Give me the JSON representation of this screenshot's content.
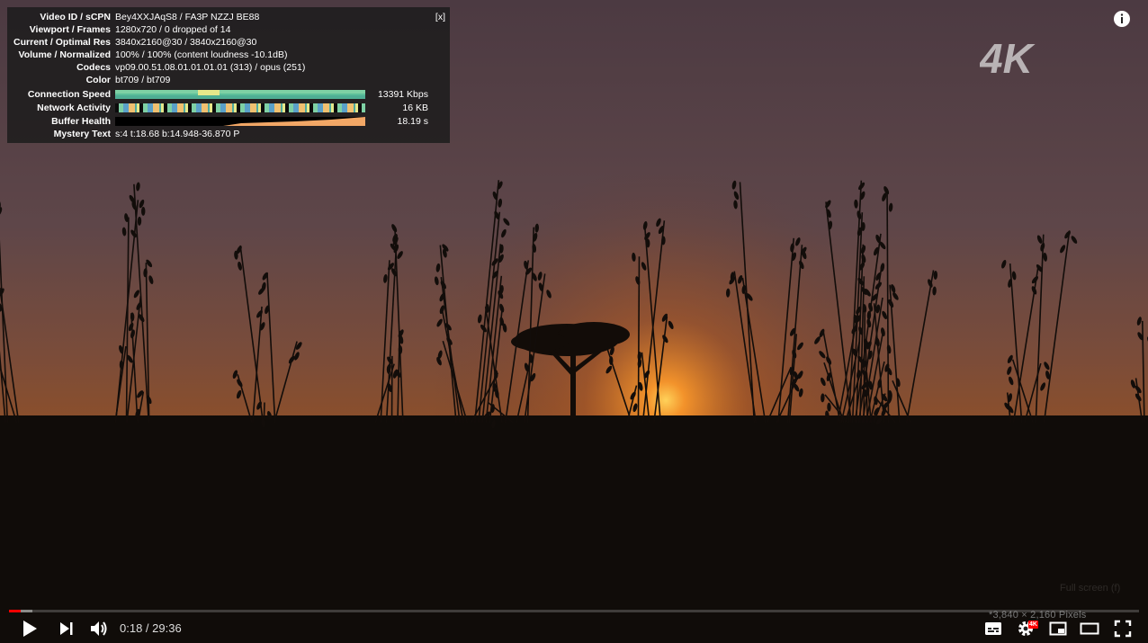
{
  "stats_panel": {
    "close_label": "[x]",
    "rows": [
      {
        "label": "Video ID / sCPN",
        "value": "Bey4XXJAqS8 / FA3P NZZJ BE88"
      },
      {
        "label": "Viewport / Frames",
        "value": "1280x720 / 0 dropped of 14"
      },
      {
        "label": "Current / Optimal Res",
        "value": "3840x2160@30 / 3840x2160@30"
      },
      {
        "label": "Volume / Normalized",
        "value": "100% / 100% (content loudness -10.1dB)"
      },
      {
        "label": "Codecs",
        "value": "vp09.00.51.08.01.01.01.01 (313) / opus (251)"
      },
      {
        "label": "Color",
        "value": "bt709 / bt709"
      }
    ],
    "graphs": [
      {
        "label": "Connection Speed",
        "value": "13391 Kbps"
      },
      {
        "label": "Network Activity",
        "value": "16 KB"
      },
      {
        "label": "Buffer Health",
        "value": "18.19 s"
      }
    ],
    "mystery": {
      "label": "Mystery Text",
      "value": "s:4 t:18.68 b:14.948-36.870 P"
    }
  },
  "overlay": {
    "logo_text": "4K",
    "fullscreen_tooltip": "Full screen (f)",
    "pixels_note": "*3,840 × 2,160 Pixels"
  },
  "player": {
    "current_time": "0:18",
    "duration": "29:36",
    "time_display": "0:18 / 29:36",
    "played_fraction": 0.0101,
    "buffered_fraction": 0.0208,
    "quality_badge": "4K"
  },
  "colors": {
    "progress_played": "#ff0000",
    "sky_top": "#5a4a52",
    "sun": "#ffb030",
    "ground": "#0e0b08"
  },
  "icons": {
    "play": "play-icon",
    "next": "next-icon",
    "volume": "volume-icon",
    "subtitles": "subtitles-icon",
    "settings": "gear-icon",
    "miniplayer": "miniplayer-icon",
    "theater": "theater-mode-icon",
    "fullscreen": "fullscreen-icon",
    "info": "info-icon"
  }
}
